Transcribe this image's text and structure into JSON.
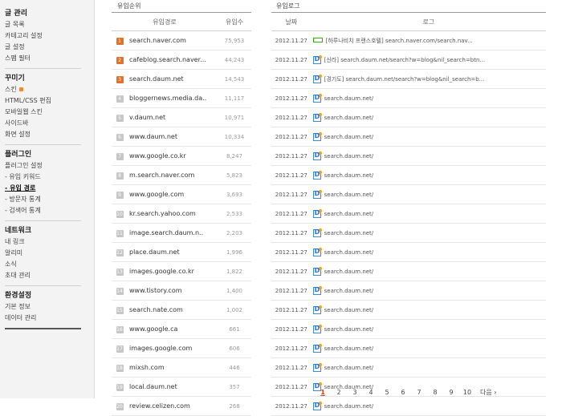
{
  "sidebar": {
    "sections": [
      {
        "title": "글 관리",
        "items": [
          "글 목록",
          "카테고리 설정",
          "글 설정",
          "스팸 필터"
        ]
      },
      {
        "title": "꾸미기",
        "items": [
          "스킨",
          "HTML/CSS 편집",
          "모바일웹 스킨",
          "사이드바",
          "화면 설정"
        ]
      },
      {
        "title": "플러그인",
        "items": [
          "플러그인 설정",
          "- 유입 키워드",
          "- 유입 경로",
          "- 방문자 통계",
          "- 검색어 통계"
        ]
      },
      {
        "title": "네트워크",
        "items": [
          "내 링크",
          "알리미",
          "소식",
          "초대 관리"
        ]
      },
      {
        "title": "환경설정",
        "items": [
          "기본 정보",
          "데이터 관리"
        ]
      }
    ]
  },
  "ranking": {
    "title": "유입순위",
    "col_source": "유입경로",
    "col_count": "유입수",
    "rows": [
      {
        "rank": "1",
        "domain": "search.naver.com",
        "count": "75,953"
      },
      {
        "rank": "2",
        "domain": "cafeblog.search.naver...",
        "count": "44,243"
      },
      {
        "rank": "3",
        "domain": "search.daum.net",
        "count": "14,543"
      },
      {
        "rank": "4",
        "domain": "bloggernews.media.da..",
        "count": "11,117"
      },
      {
        "rank": "5",
        "domain": "v.daum.net",
        "count": "10,971"
      },
      {
        "rank": "6",
        "domain": "www.daum.net",
        "count": "10,334"
      },
      {
        "rank": "7",
        "domain": "www.google.co.kr",
        "count": "8,247"
      },
      {
        "rank": "8",
        "domain": "m.search.naver.com",
        "count": "5,823"
      },
      {
        "rank": "9",
        "domain": "www.google.com",
        "count": "3,693"
      },
      {
        "rank": "10",
        "domain": "kr.search.yahoo.com",
        "count": "2,533"
      },
      {
        "rank": "11",
        "domain": "image.search.daum.n..",
        "count": "2,203"
      },
      {
        "rank": "12",
        "domain": "place.daum.net",
        "count": "1,996"
      },
      {
        "rank": "13",
        "domain": "images.google.co.kr",
        "count": "1,822"
      },
      {
        "rank": "14",
        "domain": "www.tistory.com",
        "count": "1,400"
      },
      {
        "rank": "15",
        "domain": "search.nate.com",
        "count": "1,002"
      },
      {
        "rank": "16",
        "domain": "www.google.ca",
        "count": "661"
      },
      {
        "rank": "17",
        "domain": "images.google.com",
        "count": "606"
      },
      {
        "rank": "18",
        "domain": "mixsh.com",
        "count": "446"
      },
      {
        "rank": "19",
        "domain": "local.daum.net",
        "count": "357"
      },
      {
        "rank": "20",
        "domain": "review.celizen.com",
        "count": "268"
      }
    ]
  },
  "log": {
    "title": "유입로그",
    "col_date": "날짜",
    "col_log": "로그",
    "rows": [
      {
        "date": "2012.11.27",
        "icon": "naver-icon",
        "text": "[하루나비치 프랜스호텔] search.naver.com/search.nav..."
      },
      {
        "date": "2012.11.27",
        "icon": "daum-icon",
        "text": "[신라] search.daum.net/search?w=blog&nil_search=btn..."
      },
      {
        "date": "2012.11.27",
        "icon": "daum-icon",
        "text": "[경기도] search.daum.net/search?w=blog&nil_search=b..."
      },
      {
        "date": "2012.11.27",
        "icon": "daum-icon",
        "text": "search.daum.net/"
      },
      {
        "date": "2012.11.27",
        "icon": "daum-icon",
        "text": "search.daum.net/"
      },
      {
        "date": "2012.11.27",
        "icon": "daum-icon",
        "text": "search.daum.net/"
      },
      {
        "date": "2012.11.27",
        "icon": "daum-icon",
        "text": "search.daum.net/"
      },
      {
        "date": "2012.11.27",
        "icon": "daum-icon",
        "text": "search.daum.net/"
      },
      {
        "date": "2012.11.27",
        "icon": "daum-icon",
        "text": "search.daum.net/"
      },
      {
        "date": "2012.11.27",
        "icon": "daum-icon",
        "text": "search.daum.net/"
      },
      {
        "date": "2012.11.27",
        "icon": "daum-icon",
        "text": "search.daum.net/"
      },
      {
        "date": "2012.11.27",
        "icon": "daum-icon",
        "text": "search.daum.net/"
      },
      {
        "date": "2012.11.27",
        "icon": "daum-icon",
        "text": "search.daum.net/"
      },
      {
        "date": "2012.11.27",
        "icon": "daum-icon",
        "text": "search.daum.net/"
      },
      {
        "date": "2012.11.27",
        "icon": "daum-icon",
        "text": "search.daum.net/"
      },
      {
        "date": "2012.11.27",
        "icon": "daum-icon",
        "text": "search.daum.net/"
      },
      {
        "date": "2012.11.27",
        "icon": "daum-icon",
        "text": "search.daum.net/"
      },
      {
        "date": "2012.11.27",
        "icon": "daum-icon",
        "text": "search.daum.net/"
      },
      {
        "date": "2012.11.27",
        "icon": "daum-icon",
        "text": "search.daum.net/"
      },
      {
        "date": "2012.11.27",
        "icon": "daum-icon",
        "text": "search.daum.net/"
      }
    ]
  },
  "pagination": {
    "pages": [
      "1",
      "2",
      "3",
      "4",
      "5",
      "6",
      "7",
      "8",
      "9",
      "10"
    ],
    "current": "1",
    "next_label": "다음 ›"
  },
  "colors": {
    "rank_top": "#e4702a",
    "rank_other": "#c6c6c6",
    "current_page": "#e03a1e"
  }
}
